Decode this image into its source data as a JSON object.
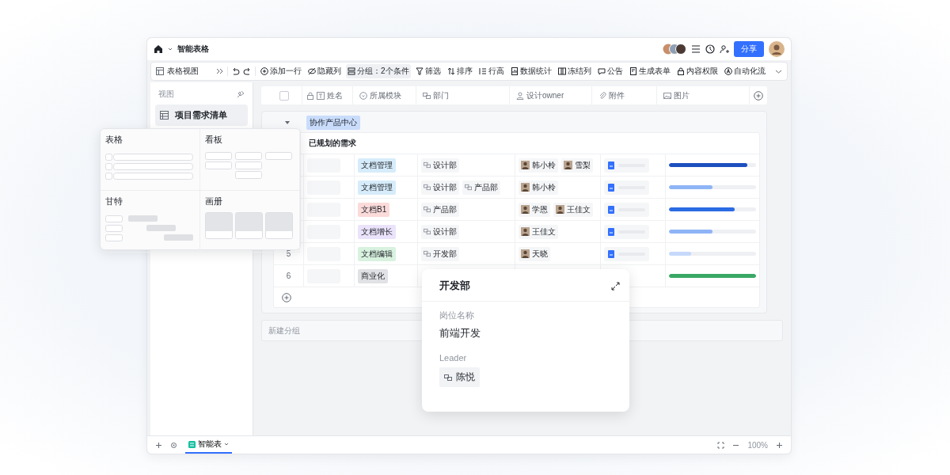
{
  "app": {
    "title": "智能表格",
    "share_label": "分享"
  },
  "toolbar": {
    "view": "表格视图",
    "items": [
      {
        "label": "添加一行",
        "kind": "add",
        "selected": false
      },
      {
        "label": "隐藏列",
        "kind": "hide",
        "selected": false
      },
      {
        "label": "分组：2个条件",
        "kind": "group",
        "selected": true
      },
      {
        "label": "筛选",
        "kind": "filter",
        "selected": false
      },
      {
        "label": "排序",
        "kind": "sort",
        "selected": false
      },
      {
        "label": "行高",
        "kind": "rowheight",
        "selected": false
      },
      {
        "label": "数据统计",
        "kind": "stats",
        "selected": false
      },
      {
        "label": "冻结列",
        "kind": "freeze",
        "selected": false
      },
      {
        "label": "公告",
        "kind": "notice",
        "selected": false
      },
      {
        "label": "生成表单",
        "kind": "form",
        "selected": false
      },
      {
        "label": "内容权限",
        "kind": "lock",
        "selected": false
      },
      {
        "label": "自动化流",
        "kind": "auto",
        "selected": false
      }
    ]
  },
  "sidebar": {
    "title": "视图",
    "views": [
      {
        "label": "项目需求清单",
        "selected": true
      }
    ]
  },
  "select_all": {
    "checked": false
  },
  "columns": [
    {
      "label": "姓名",
      "kind": "text",
      "locked": true
    },
    {
      "label": "所属模块",
      "kind": "select",
      "locked": false
    },
    {
      "label": "部门",
      "kind": "link",
      "locked": false
    },
    {
      "label": "设计owner",
      "kind": "person",
      "locked": false
    },
    {
      "label": "附件",
      "kind": "attachment",
      "locked": false
    },
    {
      "label": "图片",
      "kind": "image",
      "locked": false
    }
  ],
  "group": {
    "label": "协作产品中心",
    "expanded": true,
    "subgroup": {
      "label": "已规划的需求",
      "rows": [
        {
          "module": {
            "label": "文档管理",
            "color": "#d6ecfa"
          },
          "departments": [
            "设计部"
          ],
          "owners": [
            "韩小柃",
            "雪梨"
          ],
          "attachment": true,
          "level": 0.9,
          "color": "#1d4fbf"
        },
        {
          "module": {
            "label": "文档管理",
            "color": "#d6ecfa"
          },
          "departments": [
            "设计部",
            "产品部"
          ],
          "owners": [
            "韩小柃"
          ],
          "attachment": true,
          "level": 0.5,
          "color": "#8fb4f6"
        },
        {
          "module": {
            "label": "文档B1",
            "color": "#fbdada"
          },
          "departments": [
            "产品部"
          ],
          "owners": [
            "学恩",
            "王佳文"
          ],
          "attachment": true,
          "level": 0.75,
          "color": "#2b6be3"
        },
        {
          "module": {
            "label": "文档增长",
            "color": "#ebe3fb"
          },
          "departments": [
            "设计部"
          ],
          "owners": [
            "王佳文"
          ],
          "attachment": true,
          "level": 0.5,
          "color": "#8fb4f6"
        },
        {
          "index": "5",
          "module": {
            "label": "文档编辑",
            "color": "#d8f2df"
          },
          "departments": [
            "开发部"
          ],
          "owners": [
            "天晓"
          ],
          "attachment": true,
          "level": 0.25,
          "color": "#c6d9fb"
        },
        {
          "index": "6",
          "module": {
            "label": "商业化",
            "color": "#e1e2e5"
          },
          "level": 1,
          "color": "#3aa865"
        }
      ]
    }
  },
  "new_group": "新建分组",
  "view_picker": {
    "options": [
      {
        "label": "表格",
        "kind": "grid"
      },
      {
        "label": "看板",
        "kind": "kanban"
      },
      {
        "label": "甘特",
        "kind": "gantt"
      },
      {
        "label": "画册",
        "kind": "gallery"
      }
    ]
  },
  "department_card": {
    "title": "开发部",
    "fields": [
      {
        "label": "岗位名称",
        "value": "前端开发",
        "kind": "text"
      },
      {
        "label": "Leader",
        "value": "陈悦",
        "kind": "link"
      }
    ]
  },
  "footer": {
    "sheets": [
      {
        "label": "智能表",
        "selected": true
      }
    ],
    "zoom": "100%"
  }
}
